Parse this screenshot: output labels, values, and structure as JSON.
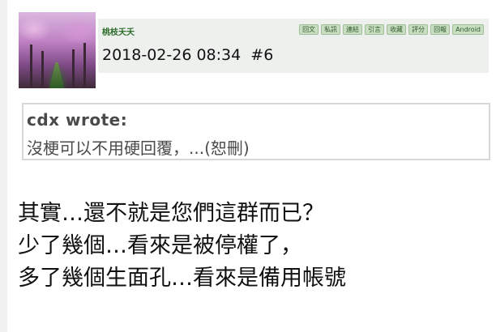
{
  "post": {
    "username": "桃枝夭夭",
    "meta": "2018-02-26 08:34  #6",
    "actions": [
      "回文",
      "私訊",
      "連結",
      "引言",
      "收藏",
      "評分",
      "回報",
      "Android"
    ]
  },
  "quote": {
    "author": "cdx wrote:",
    "text": "沒梗可以不用硬回覆，...(恕刪)"
  },
  "body": {
    "lines": [
      "其實…還不就是您們這群而已？",
      "少了幾個…看來是被停權了，",
      "多了幾個生面孔…看來是備用帳號"
    ]
  },
  "colors": {
    "username": "#2c6b2a",
    "header_bg": "#eef0ee",
    "button_bg": "#c9dec2"
  }
}
